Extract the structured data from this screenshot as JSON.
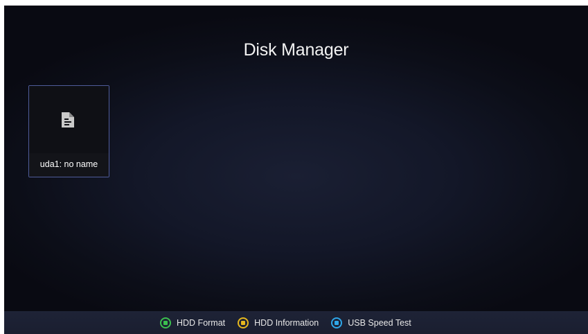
{
  "screen": {
    "title": "Disk Manager"
  },
  "disks": [
    {
      "label": "uda1: no name",
      "icon": "document-icon"
    }
  ],
  "footer": {
    "items": [
      {
        "label": "HDD Format",
        "key_color": "#3bbf4f",
        "key_name": "green-key"
      },
      {
        "label": "HDD Information",
        "key_color": "#e6b81e",
        "key_name": "yellow-key"
      },
      {
        "label": "USB Speed Test",
        "key_color": "#2ea6e8",
        "key_name": "blue-key"
      }
    ]
  },
  "colors": {
    "tile_border": "#4f5c9a",
    "background": "#131728",
    "footer_bg": "#1e2336"
  }
}
